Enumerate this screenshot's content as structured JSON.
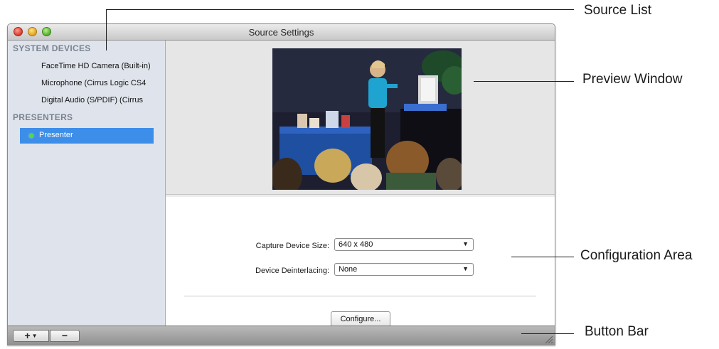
{
  "window": {
    "title": "Source Settings"
  },
  "sidebar": {
    "system_devices_header": "SYSTEM DEVICES",
    "devices": [
      "FaceTime HD Camera (Built-in)",
      "Microphone (Cirrus Logic CS4",
      "Digital Audio (S/PDIF) (Cirrus"
    ],
    "presenters_header": "PRESENTERS",
    "presenters": [
      {
        "label": "Presenter",
        "selected": true,
        "status_color": "#52d84b"
      }
    ]
  },
  "config": {
    "capture_size_label": "Capture Device Size:",
    "capture_size_value": "640 x 480",
    "deinterlace_label": "Device Deinterlacing:",
    "deinterlace_value": "None",
    "configure_button": "Configure..."
  },
  "buttonbar": {
    "add_button": "+",
    "add_icon": "plus-dropdown-icon",
    "remove_button": "−",
    "remove_icon": "minus-icon"
  },
  "callouts": {
    "source_list": "Source List",
    "preview_window": "Preview Window",
    "configuration_area": "Configuration Area",
    "button_bar": "Button Bar"
  },
  "colors": {
    "selection": "#3d8ee8",
    "sidebar_bg": "#dfe4ec",
    "header_text": "#7b8390"
  }
}
